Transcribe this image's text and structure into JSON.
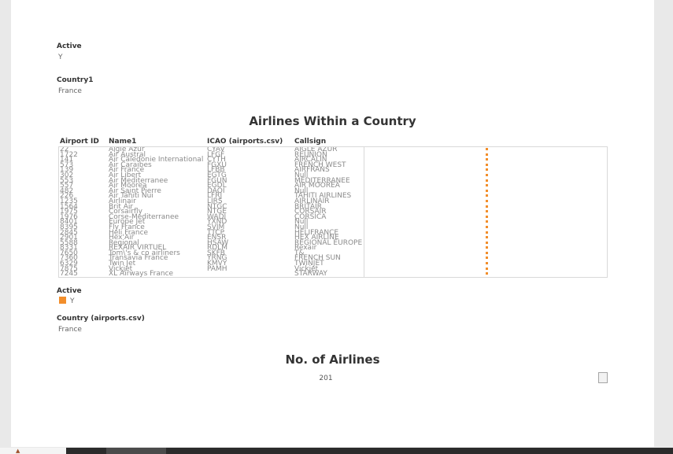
{
  "filters": {
    "active": {
      "title": "Active",
      "value": "Y"
    },
    "country1": {
      "title": "Country1",
      "value": "France"
    }
  },
  "airlines_table": {
    "title": "Airlines Within a Country",
    "columns": [
      "Airport ID",
      "Name1",
      "ICAO (airports.csv)",
      "Callsign"
    ],
    "airport_ids": [
      "22",
      "1722",
      "141",
      "573",
      "139",
      "302",
      "553",
      "557",
      "482",
      "226",
      "1235",
      "1564",
      "1975",
      "1976",
      "8401",
      "8395",
      "2845",
      "2901",
      "5588",
      "8331",
      "7650",
      "7360",
      "6329",
      "7875",
      "7245"
    ],
    "names": [
      "Aigle Azur",
      "Air Austral",
      "Air Caledonie International",
      "Air Caraibes",
      "Air France",
      "Air Libert",
      "Air Mediterranee",
      "Air Moorea",
      "Air Saint Pierre",
      "Air Tahiti Nui",
      "Airlinair",
      "Brit Air",
      "Corsairfly",
      "Corse-Mediterranee",
      "Europe Jet",
      "Fly France",
      "Heli France",
      "Hex'Air",
      "Regional",
      "REXAIR VIRTUEL",
      "Tom\\'s & co airliners",
      "Transavia France",
      "Twin Jet",
      "Vickjet",
      "XL Airways France"
    ],
    "icaos": [
      "CYAV",
      "LFGF",
      "CYTH",
      "FGXU",
      "LFBB",
      "EGTG",
      "FGUN",
      "EGDL",
      "DAOI",
      "LFRJ",
      "LIRS",
      "NTGC",
      "NTGE",
      "WADI",
      "YXND",
      "SVJM",
      "TTCP",
      "ENSR",
      "HSAW",
      "RDLM",
      "SKFB",
      "YRNG",
      "KMVY",
      "PAMH"
    ],
    "callsigns": [
      "AIGLE AZUR",
      "REUNION",
      "AIRCALIN",
      "FRENCH WEST",
      "AIRFRANS",
      "Null",
      "MEDITERRANEE",
      "AIR MOOREA",
      "Null",
      "TAHITI AIRLINES",
      "AIRLINAIR",
      "BRITAIR",
      "CORSAIR",
      "CORSICA",
      "Null",
      "Null",
      "HELIFRANCE",
      "HEX AIRLINE",
      "REGIONAL EUROPE",
      "Rexair",
      "T&",
      "FRENCH SUN",
      "TWINJET",
      "Vickjet",
      "STARWAY"
    ]
  },
  "legend": {
    "title": "Active",
    "items": [
      {
        "label": "Y",
        "color": "#f28e2b"
      }
    ]
  },
  "country_filter": {
    "title": "Country (airports.csv)",
    "value": "France"
  },
  "kpi": {
    "title": "No. of Airlines",
    "value": "201"
  },
  "colors": {
    "mark": "#f28e2b",
    "border": "#d9d9d9"
  }
}
